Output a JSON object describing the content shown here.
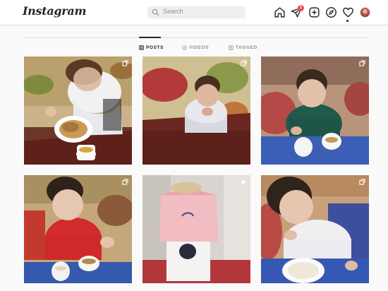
{
  "header": {
    "logo_text": "Instagram",
    "search_placeholder": "Search",
    "notification_count": "1",
    "nav_icons": [
      "home-icon",
      "direct-message-icon",
      "new-post-icon",
      "explore-icon",
      "activity-heart-icon",
      "profile-avatar"
    ]
  },
  "tabs": [
    {
      "label": "POSTS",
      "icon": "grid-icon",
      "active": true
    },
    {
      "label": "VIDEOS",
      "icon": "video-icon",
      "active": false
    },
    {
      "label": "TAGGED",
      "icon": "tagged-icon",
      "active": false
    }
  ],
  "posts": [
    {
      "type": "carousel"
    },
    {
      "type": "carousel"
    },
    {
      "type": "carousel"
    },
    {
      "type": "carousel"
    },
    {
      "type": "video"
    },
    {
      "type": "carousel"
    }
  ],
  "colors": {
    "accent_badge": "#ed4956",
    "border": "#dbdbdb",
    "text": "#262626",
    "muted": "#8e8e8e",
    "background": "#fafafa"
  }
}
